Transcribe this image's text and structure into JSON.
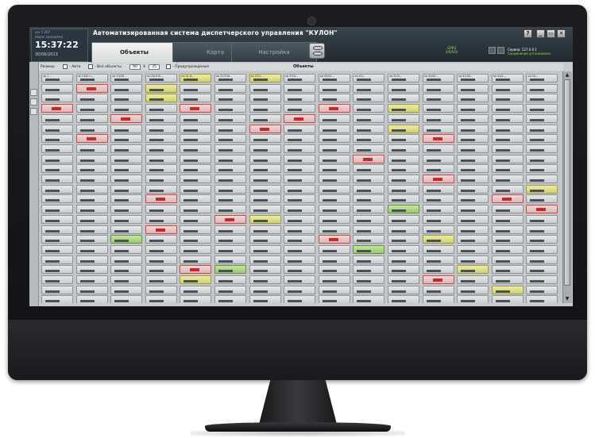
{
  "app": {
    "title": "Автоматизированная система диспетчерского управления \"КУЛОН\"",
    "version": "ver 7.207",
    "user_status": "Users: connected",
    "time": "15:37:22",
    "date": "30/06/2013"
  },
  "tabs": [
    {
      "label": "Объекты",
      "active": true
    },
    {
      "label": "Карта",
      "active": false
    },
    {
      "label": "Настройка",
      "active": false
    }
  ],
  "status": {
    "gprs_label": "GPRS",
    "gprs_value": "2/9/502",
    "server_label": "Сервер: 127.0.0.1",
    "server_state": "Соединение установлено"
  },
  "window_controls": [
    "?",
    "_",
    "▭",
    "✕"
  ],
  "options": {
    "size_label": "Размер:",
    "auto_label": "- Авто",
    "all_objects_label": "- Все объекты",
    "width_value": "90",
    "x_label": "X",
    "height_value": "35",
    "warnings_label": "- Предупреждения",
    "section_title": "Объекты"
  },
  "colors": {
    "alarm": "#c42a2a",
    "warning": "#cfcf7a",
    "ok": "#9dc873",
    "accent": "#8fdc4e"
  },
  "grid": {
    "cols": 15,
    "rows": 23,
    "cells": [
      {
        "label": "кв 1 ...",
        "state": "normal"
      },
      {
        "label": "кв 1442 п...",
        "state": "alarm"
      },
      {
        "label": "кв 23/28...",
        "state": "normal"
      },
      {
        "label": "кв 24/100...",
        "state": "normal"
      },
      {
        "label": "кв 31-6...",
        "state": "warn"
      },
      {
        "label": "кв 37/130...",
        "state": "normal"
      },
      {
        "label": "кв 37/1...",
        "state": "warn"
      },
      {
        "label": "кв 37/4...",
        "state": "normal"
      },
      {
        "label": "кв 40/41...",
        "state": "normal"
      },
      {
        "label": "кв 41/...",
        "state": "normal"
      },
      {
        "label": "кв 41/3...",
        "state": "normal"
      },
      {
        "label": "кв 41/40...",
        "state": "normal"
      },
      {
        "label": "кв 41/43...",
        "state": "normal"
      },
      {
        "label": "кв 41/2...",
        "state": "normal"
      },
      {
        "label": "кв 41/...",
        "state": "normal"
      }
    ]
  }
}
